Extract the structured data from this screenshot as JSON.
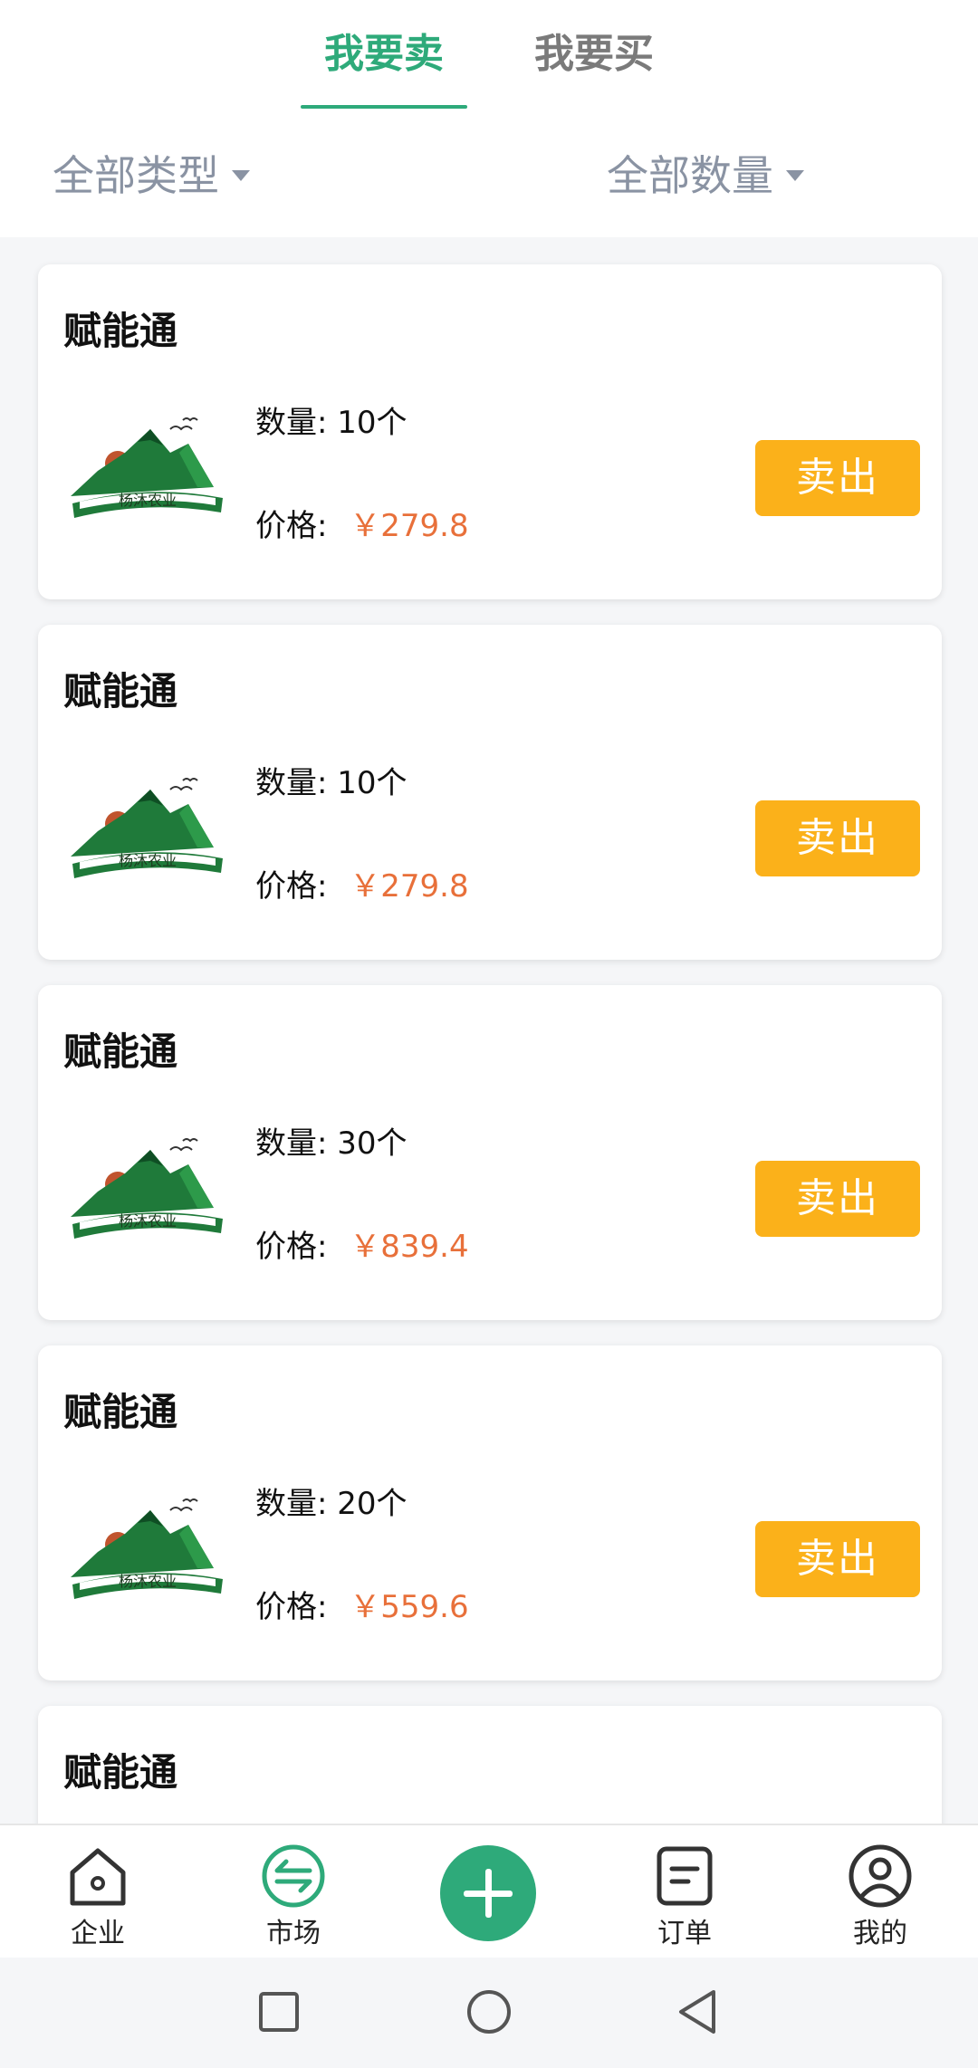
{
  "tabs": {
    "sell": "我要卖",
    "buy": "我要买"
  },
  "filters": {
    "type": "全部类型",
    "quantity": "全部数量"
  },
  "labels": {
    "quantity_prefix": "数量:",
    "price_prefix": "价格:",
    "sell_button": "卖出"
  },
  "logo": {
    "text": "杨沐农业"
  },
  "items": [
    {
      "title": "赋能通",
      "quantity": "10个",
      "price": "￥279.8"
    },
    {
      "title": "赋能通",
      "quantity": "10个",
      "price": "￥279.8"
    },
    {
      "title": "赋能通",
      "quantity": "30个",
      "price": "￥839.4"
    },
    {
      "title": "赋能通",
      "quantity": "20个",
      "price": "￥559.6"
    },
    {
      "title": "赋能通"
    }
  ],
  "nav": {
    "enterprise": "企业",
    "market": "市场",
    "orders": "订单",
    "mine": "我的"
  },
  "colors": {
    "accent": "#2eaa7a",
    "price": "#e8703a",
    "sell_button": "#fbb11a"
  }
}
